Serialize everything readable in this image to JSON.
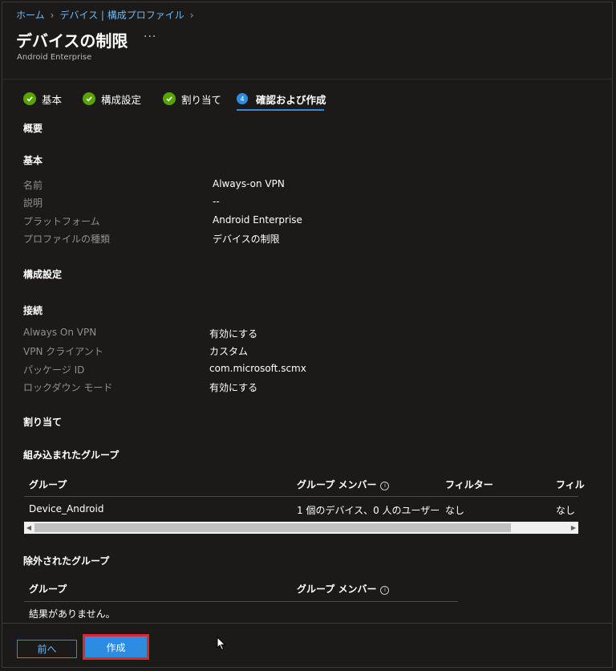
{
  "breadcrumb": {
    "home": "ホーム",
    "section": "デバイス | 構成プロファイル"
  },
  "page": {
    "title": "デバイスの制限",
    "more": "···",
    "subtitle": "Android Enterprise"
  },
  "steps": [
    {
      "label": "基本",
      "state": "done"
    },
    {
      "label": "構成設定",
      "state": "done"
    },
    {
      "label": "割り当て",
      "state": "done"
    },
    {
      "label": "確認および作成",
      "state": "active",
      "number": "4"
    }
  ],
  "summary": {
    "heading": "概要",
    "basics": {
      "heading": "基本",
      "rows": [
        {
          "key": "名前",
          "value": "Always-on VPN"
        },
        {
          "key": "説明",
          "value": "--"
        },
        {
          "key": "プラットフォーム",
          "value": "Android Enterprise"
        },
        {
          "key": "プロファイルの種類",
          "value": "デバイスの制限"
        }
      ]
    },
    "config": {
      "heading": "構成設定",
      "sub_heading": "接続",
      "rows": [
        {
          "key": "Always On VPN",
          "value": "有効にする"
        },
        {
          "key": "VPN クライアント",
          "value": "カスタム"
        },
        {
          "key": "パッケージ ID",
          "value": "com.microsoft.scmx"
        },
        {
          "key": "ロックダウン モード",
          "value": "有効にする"
        }
      ]
    },
    "assignments": {
      "heading": "割り当て",
      "included": {
        "heading": "組み込まれたグループ",
        "columns": [
          "グループ",
          "グループ メンバー",
          "フィルター",
          "フィル"
        ],
        "rows": [
          [
            "Device_Android",
            "1 個のデバイス、0 人のユーザー",
            "なし",
            "なし"
          ]
        ]
      },
      "excluded": {
        "heading": "除外されたグループ",
        "columns": [
          "グループ",
          "グループ メンバー"
        ],
        "empty": "結果がありません。"
      }
    }
  },
  "footer": {
    "prev": "前へ",
    "create": "作成"
  },
  "colors": {
    "background": "#1b1a19",
    "accent": "#2d8be0",
    "success": "#57a300",
    "highlight": "#e0262b"
  }
}
